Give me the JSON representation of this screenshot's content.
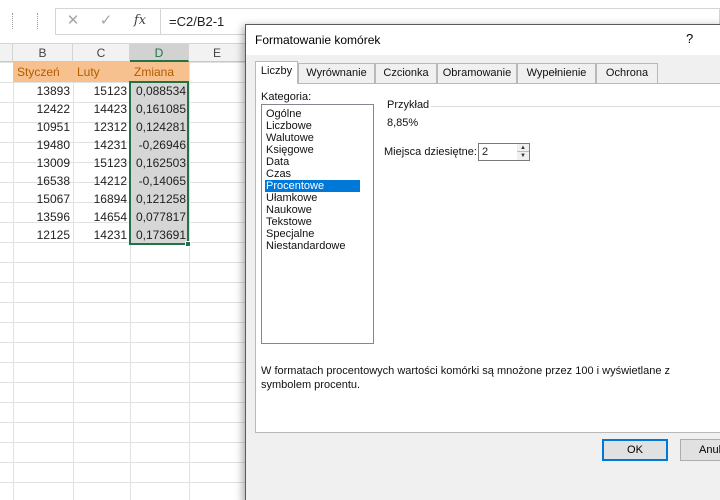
{
  "formula_bar": {
    "cancel_icon": "x-icon",
    "enter_icon": "check-icon",
    "fx_label": "fx",
    "formula": "=C2/B2-1"
  },
  "sheet": {
    "columns": [
      "B",
      "C",
      "D",
      "E"
    ],
    "header_row": [
      "Styczeń",
      "Luty",
      "Zmiana"
    ],
    "rows": [
      [
        "13893",
        "15123",
        "0,088534"
      ],
      [
        "12422",
        "14423",
        "0,161085"
      ],
      [
        "10951",
        "12312",
        "0,124281"
      ],
      [
        "19480",
        "14231",
        "-0,26946"
      ],
      [
        "13009",
        "15123",
        "0,162503"
      ],
      [
        "16538",
        "14212",
        "-0,14065"
      ],
      [
        "15067",
        "16894",
        "0,121258"
      ],
      [
        "13596",
        "14654",
        "0,077817"
      ],
      [
        "12125",
        "14231",
        "0,173691"
      ]
    ],
    "header_color": "#f6c18e",
    "selection_color": "#217346"
  },
  "dialog": {
    "title": "Formatowanie komórek",
    "help": "?",
    "tabs": [
      "Liczby",
      "Wyrównanie",
      "Czcionka",
      "Obramowanie",
      "Wypełnienie",
      "Ochrona"
    ],
    "active_tab": "Liczby",
    "category_label": "Kategoria:",
    "categories": [
      "Ogólne",
      "Liczbowe",
      "Walutowe",
      "Księgowe",
      "Data",
      "Czas",
      "Procentowe",
      "Ułamkowe",
      "Naukowe",
      "Tekstowe",
      "Specjalne",
      "Niestandardowe"
    ],
    "selected_category": "Procentowe",
    "sample_label": "Przykład",
    "sample_value": "8,85%",
    "decimals_label": "Miejsca dziesiętne:",
    "decimals_value": "2",
    "description": "W formatach procentowych wartości komórki są mnożone przez 100 i wyświetlane z symbolem procentu.",
    "ok_label": "OK",
    "cancel_label": "Anul",
    "accent_color": "#0078d7"
  }
}
